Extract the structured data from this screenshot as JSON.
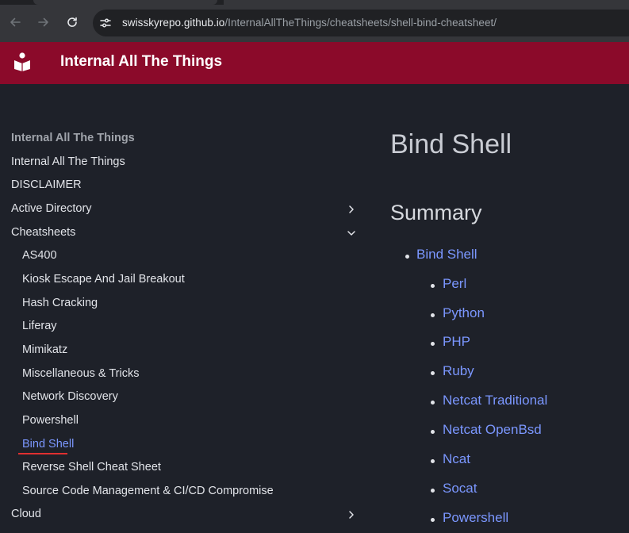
{
  "browser": {
    "url_host": "swisskyrepo.github.io",
    "url_path": "/InternalAllTheThings/cheatsheets/shell-bind-cheatsheet/",
    "icons": {
      "back": "arrow-left-icon",
      "forward": "arrow-right-icon",
      "reload": "reload-icon",
      "site_info": "tune-icon"
    }
  },
  "site": {
    "title": "Internal All The Things",
    "logo": "book-reader-icon",
    "brand_color": "#8b0a2a"
  },
  "nav": {
    "heading": "Internal All The Things",
    "items": [
      {
        "label": "Internal All The Things"
      },
      {
        "label": "DISCLAIMER"
      },
      {
        "label": "Active Directory",
        "expanded": false
      },
      {
        "label": "Cheatsheets",
        "expanded": true
      },
      {
        "label": "Cloud",
        "expanded": false
      }
    ],
    "sub_items": [
      {
        "label": "AS400"
      },
      {
        "label": "Kiosk Escape And Jail Breakout"
      },
      {
        "label": "Hash Cracking"
      },
      {
        "label": "Liferay"
      },
      {
        "label": "Mimikatz"
      },
      {
        "label": "Miscellaneous & Tricks"
      },
      {
        "label": "Network Discovery"
      },
      {
        "label": "Powershell"
      },
      {
        "label": "Bind Shell",
        "active": true
      },
      {
        "label": "Reverse Shell Cheat Sheet"
      },
      {
        "label": "Source Code Management & CI/CD Compromise"
      }
    ]
  },
  "content": {
    "page_title": "Bind Shell",
    "section_title": "Summary",
    "toc": {
      "top": "Bind Shell",
      "children": [
        "Perl",
        "Python",
        "PHP",
        "Ruby",
        "Netcat Traditional",
        "Netcat OpenBsd",
        "Ncat",
        "Socat",
        "Powershell"
      ]
    },
    "link_color": "#7b97ff"
  }
}
